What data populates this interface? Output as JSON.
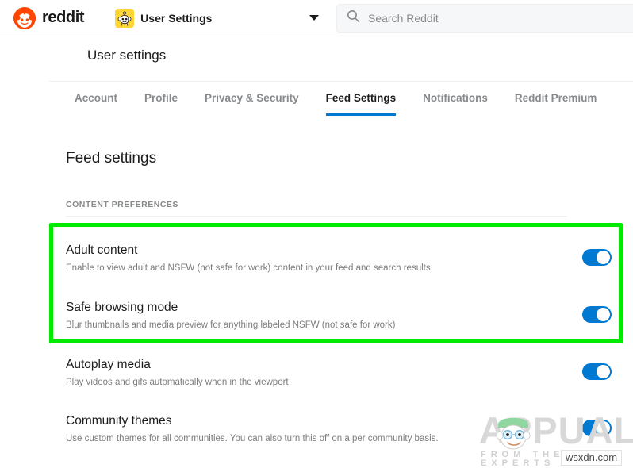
{
  "header": {
    "logo_word": "reddit",
    "logo_icon": "reddit-alien-icon",
    "user_dropdown_label": "User Settings",
    "avatar_icon": "snoo-avatar-icon",
    "chevron_icon": "chevron-down-icon",
    "search": {
      "icon": "search-icon",
      "placeholder": "Search Reddit",
      "value": ""
    }
  },
  "page": {
    "title": "User settings"
  },
  "tabs": [
    {
      "label": "Account",
      "active": false
    },
    {
      "label": "Profile",
      "active": false
    },
    {
      "label": "Privacy & Security",
      "active": false
    },
    {
      "label": "Feed Settings",
      "active": true
    },
    {
      "label": "Notifications",
      "active": false
    },
    {
      "label": "Reddit Premium",
      "active": false
    }
  ],
  "feed_settings": {
    "heading": "Feed settings",
    "section_label": "CONTENT PREFERENCES",
    "rows": [
      {
        "name": "Adult content",
        "description": "Enable to view adult and NSFW (not safe for work) content in your feed and search results",
        "toggle_state": "on"
      },
      {
        "name": "Safe browsing mode",
        "description": "Blur thumbnails and media preview for anything labeled NSFW (not safe for work)",
        "toggle_state": "on"
      },
      {
        "name": "Autoplay media",
        "description": "Play videos and gifs automatically when in the viewport",
        "toggle_state": "on"
      },
      {
        "name": "Community themes",
        "description": "Use custom themes for all communities. You can also turn this off on a per community basis.",
        "toggle_state": "on"
      }
    ]
  },
  "highlight": {
    "color": "#00eb00",
    "covers": [
      "Adult content",
      "Safe browsing mode"
    ]
  },
  "watermark": {
    "text": "APPUALS",
    "tagline": "FROM THE EXPERTS",
    "badge": "wsxdn.com"
  },
  "colors": {
    "accent_blue": "#0079d3",
    "brand_orange": "#ff4500",
    "highlight_green": "#00eb00",
    "text_primary": "#1c1c1c",
    "text_muted": "#878a8c"
  }
}
